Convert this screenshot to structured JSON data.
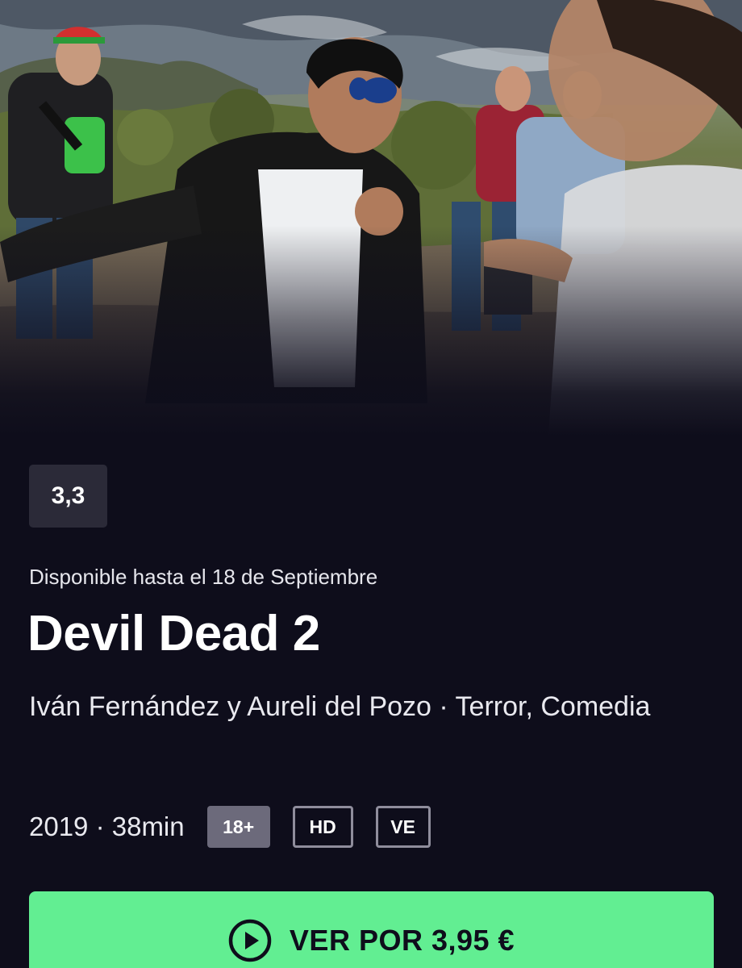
{
  "hero": {
    "image_name": "movie-still-image"
  },
  "rating": {
    "score": "3,3"
  },
  "movie": {
    "availability": "Disponible hasta el 18 de Septiembre",
    "title": "Devil Dead 2",
    "credits": "Iván Fernández y Aureli del Pozo · Terror, Comedia",
    "year_duration": "2019 · 38min",
    "age_rating": "18+",
    "badges": [
      "HD",
      "VE"
    ]
  },
  "cta": {
    "label": "VER POR 3,95 €",
    "icon": "play-circle-icon"
  },
  "colors": {
    "background": "#0e0d1b",
    "accent": "#62ee92",
    "rating_bg": "#2b2a38",
    "age_badge_bg": "#6c6a7b",
    "outline_badge": "#8f8d9c"
  }
}
